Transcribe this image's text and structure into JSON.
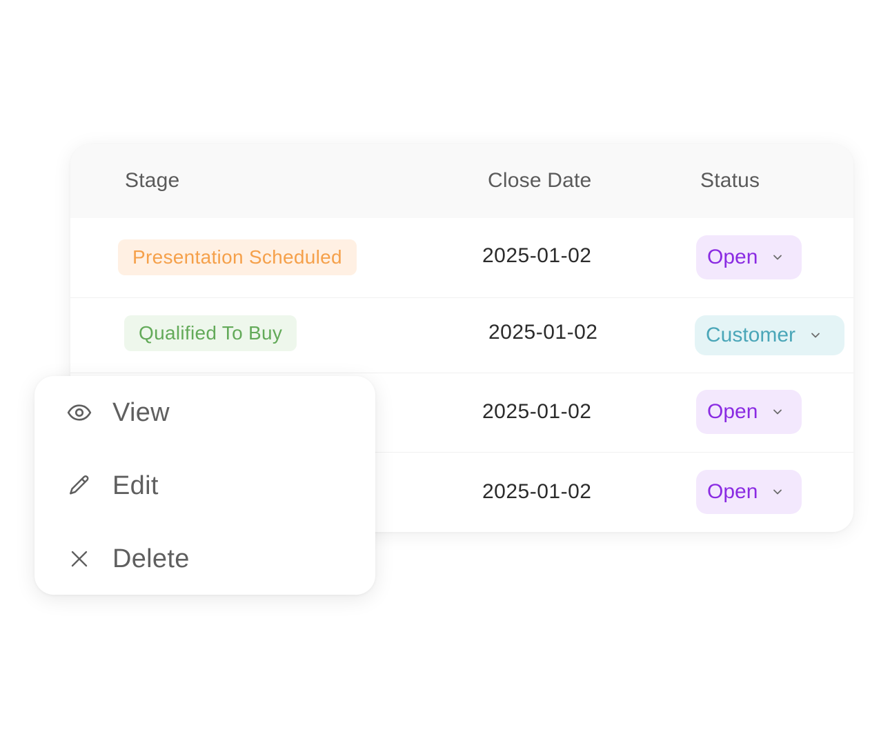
{
  "table": {
    "headers": {
      "stage": "Stage",
      "close_date": "Close Date",
      "status": "Status"
    },
    "rows": [
      {
        "stage": "Presentation Scheduled",
        "stage_color": "orange",
        "close_date": "2025-01-02",
        "status": "Open",
        "status_color": "purple"
      },
      {
        "stage": "Qualified To Buy",
        "stage_color": "green",
        "close_date": "2025-01-02",
        "status": "Customer",
        "status_color": "teal"
      },
      {
        "stage": "",
        "close_date": "2025-01-02",
        "status": "Open",
        "status_color": "purple"
      },
      {
        "stage": "",
        "close_date": "2025-01-02",
        "status": "Open",
        "status_color": "purple"
      }
    ]
  },
  "context_menu": {
    "items": [
      {
        "label": "View",
        "icon": "eye-icon"
      },
      {
        "label": "Edit",
        "icon": "pencil-icon"
      },
      {
        "label": "Delete",
        "icon": "close-icon"
      }
    ]
  },
  "colors": {
    "stage_orange_bg": "#fff0e3",
    "stage_orange_text": "#f5a04a",
    "stage_green_bg": "#eef7ec",
    "stage_green_text": "#63aa59",
    "status_purple_bg": "#f3e8fd",
    "status_purple_text": "#8a2be2",
    "status_teal_bg": "#e4f4f6",
    "status_teal_text": "#4aa6b8"
  }
}
